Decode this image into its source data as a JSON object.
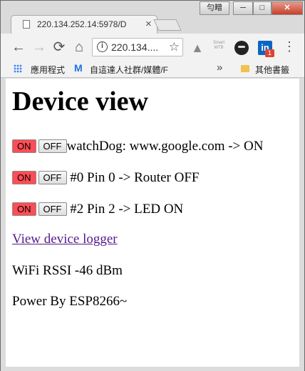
{
  "window": {
    "ime_label": "勻㽪",
    "min_label": "─",
    "max_label": "□",
    "close_label": "✕"
  },
  "tab": {
    "title": "220.134.252.14:5978/D",
    "close_label": "×"
  },
  "toolbar": {
    "back_icon": "←",
    "forward_icon": "→",
    "reload_icon": "⟳",
    "home_icon": "⌂",
    "url": "220.134....",
    "info_icon": "i",
    "star_icon": "☆",
    "menu_icon": "⋮",
    "ext_drive": "▲",
    "ext_smart": "Smart\nWTB",
    "ext_linkedin": "in",
    "ext_linkedin_badge": "1"
  },
  "bookmarks": {
    "apps_label": "應用程式",
    "gmail_icon": "M",
    "item1_label": "自這達人社群/媒體/F",
    "more_label": "»",
    "other_label": "其他書籤"
  },
  "page": {
    "heading": "Device view",
    "devices": [
      {
        "on_label": "ON",
        "off_label": "OFF",
        "text": "watchDog: www.google.com -> ON"
      },
      {
        "on_label": "ON",
        "off_label": "OFF",
        "text": "#0 Pin 0 -> Router OFF"
      },
      {
        "on_label": "ON",
        "off_label": "OFF",
        "text": "#2 Pin 2 -> LED ON"
      }
    ],
    "logger_link": "View device logger",
    "rssi": "WiFi RSSI -46 dBm",
    "footer": "Power By ESP8266~"
  },
  "colors": {
    "on_button": "#ff4d55",
    "visited_link": "#551a8b",
    "titlebar": "#dadada"
  }
}
